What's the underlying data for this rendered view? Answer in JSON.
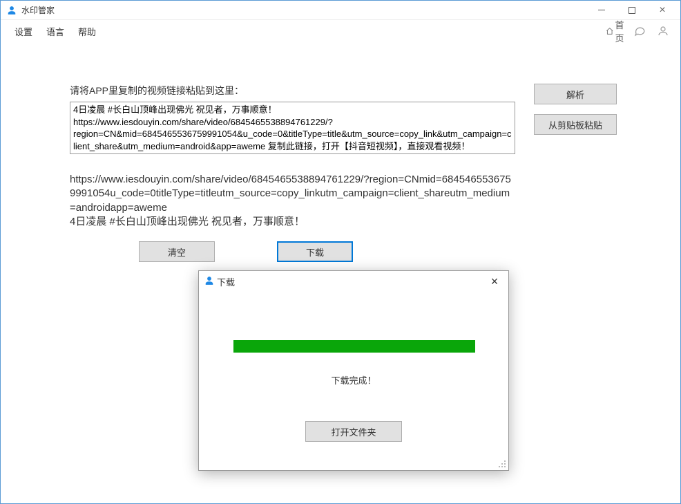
{
  "app": {
    "title": "水印管家"
  },
  "menu": {
    "settings": "设置",
    "language": "语言",
    "help": "帮助",
    "home": "首页"
  },
  "main": {
    "instruction": "请将APP里复制的视频链接粘贴到这里：",
    "input_value": "4日凌晨 #长白山顶峰出现佛光 祝见者，万事顺意！ https://www.iesdouyin.com/share/video/6845465538894761229/?region=CN&mid=6845465536759991054&u_code=0&titleType=title&utm_source=copy_link&utm_campaign=client_share&utm_medium=android&app=aweme 复制此链接，打开【抖音短视频】，直接观看视频！",
    "parse_btn": "解析",
    "paste_btn": "从剪贴板粘贴",
    "parsed_text": "https://www.iesdouyin.com/share/video/6845465538894761229/?region=CNmid=6845465536759991054u_code=0titleType=titleutm_source=copy_linkutm_campaign=client_shareutm_medium=androidapp=aweme\n4日凌晨 #长白山顶峰出现佛光 祝见者，万事顺意！",
    "clear_btn": "清空",
    "download_btn": "下载"
  },
  "dialog": {
    "title": "下载",
    "status": "下载完成！",
    "open_folder_btn": "打开文件夹"
  },
  "colors": {
    "progress": "#0aa60a",
    "accent": "#0078d7"
  }
}
